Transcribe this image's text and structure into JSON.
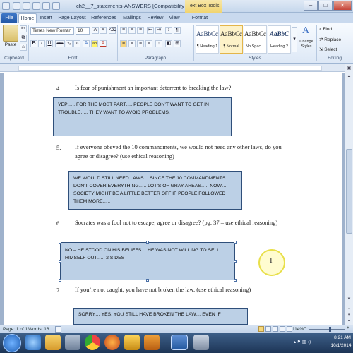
{
  "window": {
    "title": "ch2__7_statements-ANSWERS [Compatibility Mode] - Mi...",
    "context_tab": "Text Box Tools",
    "minimize_glyph": "–",
    "maximize_glyph": "□",
    "close_glyph": "✕"
  },
  "tabs": [
    "File",
    "Home",
    "Insert",
    "Page Layout",
    "References",
    "Mailings",
    "Review",
    "View",
    "Format"
  ],
  "ribbon": {
    "clipboard": {
      "paste_label": "Paste",
      "group_label": "Clipboard"
    },
    "font": {
      "font_name": "Times New Roman",
      "font_size": "10",
      "grow_label": "A",
      "shrink_label": "A",
      "bold": "B",
      "italic": "I",
      "underline": "U",
      "strike": "abe",
      "subscript": "x₂",
      "superscript": "x²",
      "font_color": "A",
      "highlight": "ab",
      "group_label": "Font"
    },
    "paragraph": {
      "group_label": "Paragraph",
      "show_marks": "¶"
    },
    "styles": {
      "items": [
        {
          "sample": "AaBbCcDc",
          "name": "¶ Heading 1"
        },
        {
          "sample": "AaBbCcDc",
          "name": "¶ Normal"
        },
        {
          "sample": "AaBbCcDc",
          "name": "No Spaci..."
        },
        {
          "sample": "AaBbC",
          "name": "Heading 2"
        }
      ],
      "change_styles": "Change Styles",
      "group_label": "Styles"
    },
    "editing": {
      "find": "Find",
      "replace": "Replace",
      "select": "Select",
      "group_label": "Editing"
    }
  },
  "document": {
    "questions": [
      {
        "num": "4.",
        "text": "Is fear of punishment an important deterrent to breaking the law?"
      },
      {
        "num": "5.",
        "text": "If everyone obeyed the 10 commandments, we would not need any other laws,  do you agree or disagree? (use ethical reasoning)"
      },
      {
        "num": "6.",
        "text": "Socrates was a fool not to escape, agree or disagree? (pg. 37 – use ethical reasoning)"
      },
      {
        "num": "7.",
        "text": "If you’re not caught, you have not broken the law.  (use ethical reasoning)"
      }
    ],
    "answers": [
      "YEP….. FOR THE MOST PART…. PEOPLE DON’T WANT TO GET IN TROUBLE….. THEY WANT TO AVOID PROBLEMS.",
      "WE WOULD STILL NEED LAWS… SINCE THE 10 COMMANDMENTS DON’T COVER EVERYTHING….. LOT’S OF GRAY AREAS….. NOW… SOCIETY MIGHT BE A LITTLE BETTER OFF IF PEOPLE FOLLOWED THEM MORE…..",
      "NO – HE STOOD ON HIS BELIEFS…  HE WAS NOT WILLING TO SELL HIMSELF OUT…..  2 SIDES",
      "SORRY… YES, YOU STILL HAVE BROKEN THE LAW… EVEN IF"
    ]
  },
  "status": {
    "page": "Page: 1 of 1",
    "words": "Words: 16",
    "zoom": "114%"
  },
  "taskbar": {
    "time": "8:21 AM",
    "date": "10/1/2014"
  }
}
